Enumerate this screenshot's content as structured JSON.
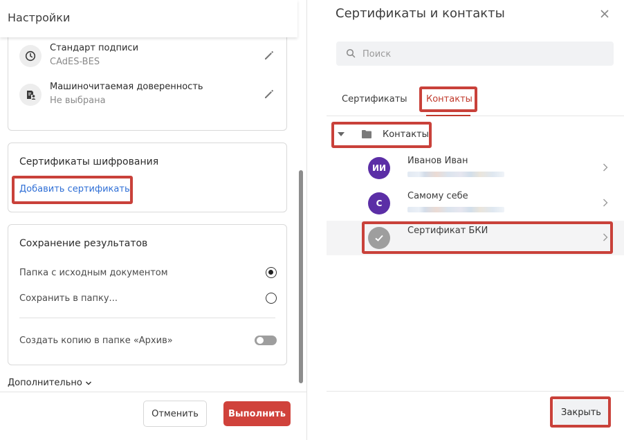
{
  "left_panel": {
    "title": "Настройки",
    "signature_rows": [
      {
        "title": "Стандарт подписи",
        "value": "CAdES-BES",
        "icon": "clock-icon"
      },
      {
        "title": "Машиночитаемая доверенность",
        "value": "Не выбрана",
        "icon": "document-person-icon"
      }
    ],
    "encryption": {
      "title": "Сертификаты шифрования",
      "add_link": "Добавить сертификаты"
    },
    "save_results": {
      "title": "Сохранение результатов",
      "option_source_folder": "Папка с исходным документом",
      "option_save_to_folder": "Сохранить в папку...",
      "selected": "Папка с исходным документом",
      "archive_copy_label": "Создать копию в папке «Архив»",
      "archive_copy_enabled": false
    },
    "more_label": "Дополнительно",
    "cancel_label": "Отменить",
    "run_label": "Выполнить"
  },
  "right_panel": {
    "title": "Сертификаты и контакты",
    "search_placeholder": "Поиск",
    "tabs": [
      {
        "label": "Сертификаты",
        "active": false
      },
      {
        "label": "Контакты",
        "active": true
      }
    ],
    "folder_label": "Контакты",
    "contacts": [
      {
        "initials": "ИИ",
        "name": "Иванов Иван",
        "color": "#5b2ea6",
        "selected": false
      },
      {
        "initials": "С",
        "name": "Самому себе",
        "color": "#5b2ea6",
        "selected": false
      },
      {
        "initials": "",
        "name": "Сертификат БКИ",
        "color": "#9e9e9e",
        "selected": true
      }
    ],
    "close_label": "Закрыть"
  },
  "colors": {
    "accent_red": "#d0423b",
    "highlight_red": "#c9413a",
    "link_blue": "#2f6fd6",
    "avatar_purple": "#5b2ea6"
  }
}
